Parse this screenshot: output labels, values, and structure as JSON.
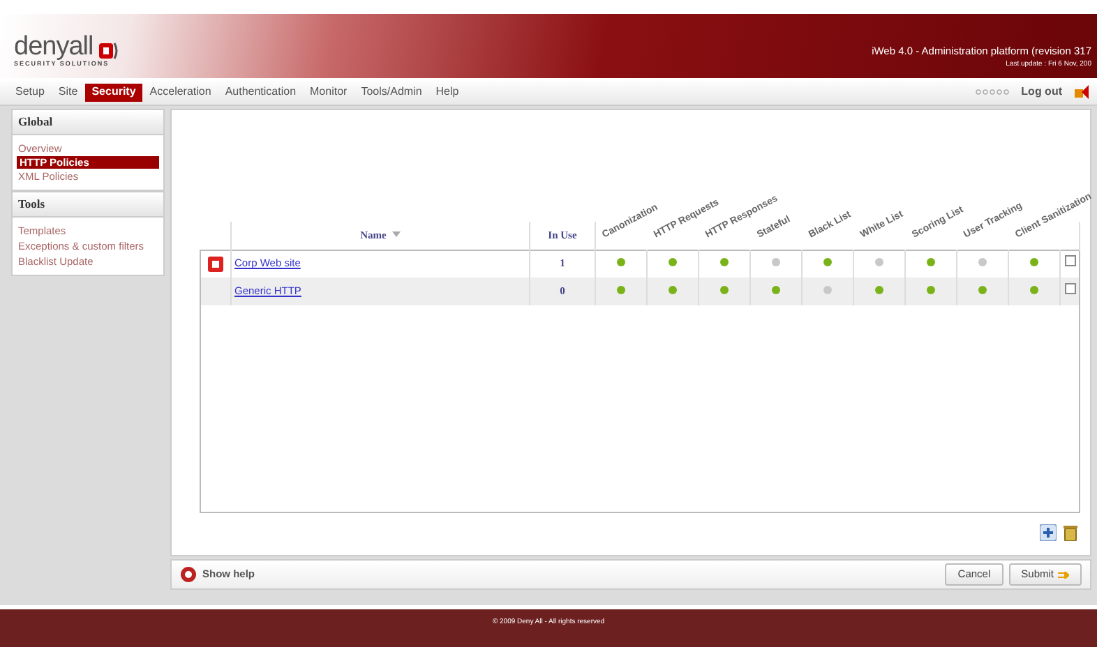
{
  "header": {
    "logo": "denyall",
    "logo_tagline": "SECURITY SOLUTIONS",
    "title": "iWeb 4.0 - Administration platform (revision 317",
    "last_update": "Last update : Fri 6 Nov, 200"
  },
  "nav": {
    "items": [
      {
        "label": "Setup",
        "selected": false
      },
      {
        "label": "Site",
        "selected": false
      },
      {
        "label": "Security",
        "selected": true
      },
      {
        "label": "Acceleration",
        "selected": false
      },
      {
        "label": "Authentication",
        "selected": false
      },
      {
        "label": "Monitor",
        "selected": false
      },
      {
        "label": "Tools/Admin",
        "selected": false
      },
      {
        "label": "Help",
        "selected": false
      }
    ],
    "logout": "Log out"
  },
  "sidebar": [
    {
      "title": "Global",
      "items": [
        {
          "label": "Overview",
          "selected": false
        },
        {
          "label": "HTTP Policies",
          "selected": true
        },
        {
          "label": "XML Policies",
          "selected": false
        }
      ]
    },
    {
      "title": "Tools",
      "items": [
        {
          "label": "Templates",
          "selected": false
        },
        {
          "label": "Exceptions & custom filters",
          "selected": false
        },
        {
          "label": "Blacklist Update",
          "selected": false
        }
      ]
    }
  ],
  "table": {
    "columns": [
      "Name",
      "In Use",
      "Canonization",
      "HTTP Requests",
      "HTTP Responses",
      "Stateful",
      "Black List",
      "White List",
      "Scoring List",
      "User Tracking",
      "Client Sanitization"
    ],
    "rows": [
      {
        "name": "Corp Web site",
        "in_use": "1",
        "default": true,
        "checked": false,
        "features": [
          true,
          true,
          true,
          false,
          true,
          false,
          true,
          false,
          true
        ]
      },
      {
        "name": "Generic HTTP",
        "in_use": "0",
        "default": false,
        "checked": false,
        "features": [
          true,
          true,
          true,
          true,
          false,
          true,
          true,
          true,
          true
        ]
      }
    ]
  },
  "help": "Show help",
  "buttons": [
    "Cancel",
    "Submit"
  ],
  "footer": "© 2009 Deny All - All rights reserved"
}
